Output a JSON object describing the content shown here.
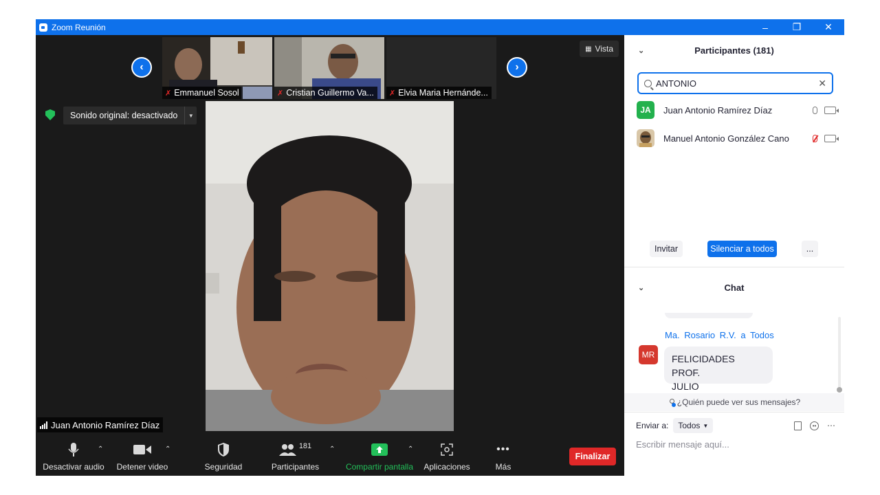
{
  "window": {
    "title": "Zoom Reunión"
  },
  "strip": {
    "thumbnails": [
      {
        "name": "Emmanuel Sosol"
      },
      {
        "name": "Cristian Guillermo Va..."
      },
      {
        "name": "Elvia Maria Hernánde..."
      }
    ]
  },
  "view_button": {
    "label": "Vista"
  },
  "original_sound": {
    "label": "Sonido original: desactivado"
  },
  "active_speaker": {
    "name": "Juan Antonio Ramírez Díaz"
  },
  "toolbar": {
    "audio": "Desactivar audio",
    "video": "Detener video",
    "security": "Seguridad",
    "participants": "Participantes",
    "participants_count": "181",
    "share": "Compartir pantalla",
    "apps": "Aplicaciones",
    "more": "Más",
    "end": "Finalizar"
  },
  "participants_panel": {
    "title": "Participantes (181)",
    "search_value": "ANTONIO",
    "rows": [
      {
        "initials": "JA",
        "name": "Juan Antonio Ramírez Díaz",
        "avatar_color": "#23b14d"
      },
      {
        "initials": "",
        "name": "Manuel Antonio González Cano",
        "avatar_color": "#7a5a3a"
      }
    ],
    "invite": "Invitar",
    "mute_all": "Silenciar a todos",
    "more": "..."
  },
  "chat_panel": {
    "title": "Chat",
    "message": {
      "from": "Ma. Rosario R.V. a Todos",
      "avatar_initials": "MR",
      "text_line1": "FELICIDADES PROF.",
      "text_line2": "JULIO CHAVARRILLO"
    },
    "who_can_see": "¿Quién puede ver sus mensajes?",
    "send_to_label": "Enviar a:",
    "send_to_value": "Todos",
    "input_placeholder": "Escribir mensaje aquí..."
  },
  "colors": {
    "zoom_blue": "#0e71eb",
    "end_red": "#e02828",
    "share_green": "#23c05a",
    "dark_bg": "#1a1a1a"
  }
}
